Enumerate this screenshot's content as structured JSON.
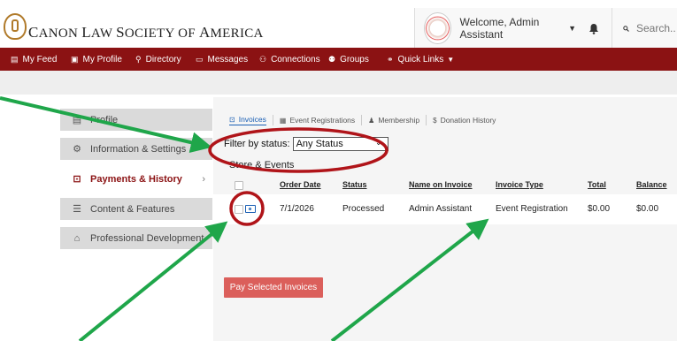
{
  "header": {
    "logo_text_first": "C",
    "logo_text_rest": "ANON ",
    "logo_text_2_first": "L",
    "logo_text_2_rest": "AW ",
    "logo_text_3_first": "S",
    "logo_text_3_rest": "OCIETY OF ",
    "logo_text_4_first": "A",
    "logo_text_4_rest": "MERICA",
    "welcome": "Welcome, Admin Assistant",
    "search_placeholder": "Search..."
  },
  "nav": {
    "items": [
      {
        "label": "My Feed",
        "icon": "feed-icon"
      },
      {
        "label": "My Profile",
        "icon": "profile-icon"
      },
      {
        "label": "Directory",
        "icon": "search-icon"
      },
      {
        "label": "Messages",
        "icon": "inbox-icon"
      },
      {
        "label": "Connections",
        "icon": "connections-icon"
      },
      {
        "label": "Groups",
        "icon": "groups-icon"
      },
      {
        "label": "Quick Links",
        "icon": "link-icon"
      }
    ]
  },
  "sidebar": {
    "items": [
      {
        "label": "Profile",
        "icon": "profile-card-icon"
      },
      {
        "label": "Information & Settings",
        "icon": "gears-icon"
      },
      {
        "label": "Payments & History",
        "icon": "money-icon"
      },
      {
        "label": "Content & Features",
        "icon": "list-icon"
      },
      {
        "label": "Professional Development",
        "icon": "graduation-cap-icon"
      }
    ]
  },
  "tabs": [
    {
      "label": "Invoices",
      "icon": "money-icon"
    },
    {
      "label": "Event Registrations",
      "icon": "calendar-icon"
    },
    {
      "label": "Membership",
      "icon": "user-icon"
    },
    {
      "label": "Donation History",
      "icon": "dollar-icon"
    }
  ],
  "filter": {
    "label": "Filter by status:",
    "value": "Any Status"
  },
  "section_title": "Store & Events",
  "table": {
    "headers": [
      "Order Date",
      "Status",
      "Name on Invoice",
      "Invoice Type",
      "Total",
      "Balance"
    ],
    "rows": [
      {
        "order_date": "7/1/2026",
        "status": "Processed",
        "name": "Admin Assistant",
        "type": "Event Registration",
        "total": "$0.00",
        "balance": "$0.00"
      }
    ]
  },
  "pay_button": "Pay Selected Invoices",
  "colors": {
    "brand": "#8b1213",
    "link": "#1a5fb4",
    "annotation_arrow": "#1fa64a",
    "annotation_circle": "#b01419",
    "pay_button": "#d9534f"
  }
}
